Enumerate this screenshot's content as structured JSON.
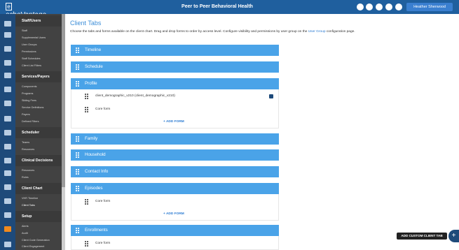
{
  "topbar": {
    "logo": "echoVantage",
    "brand": "Peer to Peer Behavioral Health",
    "user": "Heather Sherwood",
    "icons": [
      "bell-icon",
      "user-icon",
      "settings-icon",
      "notification-icon",
      "help-icon"
    ]
  },
  "sidebar": {
    "sections": [
      {
        "title": "Staff/Users",
        "items": [
          "Staff",
          "Supplemental Users",
          "User Groups",
          "Permissions",
          "Staff Schedules",
          "Client List Filters"
        ]
      },
      {
        "title": "Services/Payers",
        "items": [
          "Components",
          "Programs",
          "Sliding Fees",
          "Service Definitions",
          "Payers",
          "Defined Filters"
        ]
      },
      {
        "title": "Scheduler",
        "items": [
          "Teams",
          "Resources"
        ]
      },
      {
        "title": "Clinical Decisions",
        "items": [
          "Resources",
          "Roles"
        ]
      },
      {
        "title": "Client Chart",
        "items": [
          "VHR Timeline",
          "Client Tabs"
        ]
      },
      {
        "title": "Setup",
        "items": [
          "Alerts",
          "Audit",
          "Client Code Generation",
          "Client Engagement"
        ]
      }
    ]
  },
  "page": {
    "title": "Client Tabs",
    "description_before": "Choose the tabs and forms available on the client chart. Drag and drop forms to order by access level. Configure visibility and permissions by user group on the ",
    "description_link": "User Group",
    "description_after": " configuration page."
  },
  "tabs": [
    {
      "label": "Timeline"
    },
    {
      "label": "Schedule"
    },
    {
      "label": "Profile",
      "forms": [
        "client_demographic_v210 (client_demographic_v210)",
        "Core form"
      ],
      "add_label": "+ ADD FORM"
    },
    {
      "label": "Family"
    },
    {
      "label": "Household"
    },
    {
      "label": "Contact Info"
    },
    {
      "label": "Episodes",
      "forms": [
        "Core form"
      ],
      "add_label": "+ ADD FORM"
    },
    {
      "label": "Enrollments",
      "forms": [
        "Core form"
      ]
    }
  ],
  "actions": {
    "add_custom_tab": "ADD CUSTOM CLIENT TAB",
    "fab_symbol": "+"
  }
}
